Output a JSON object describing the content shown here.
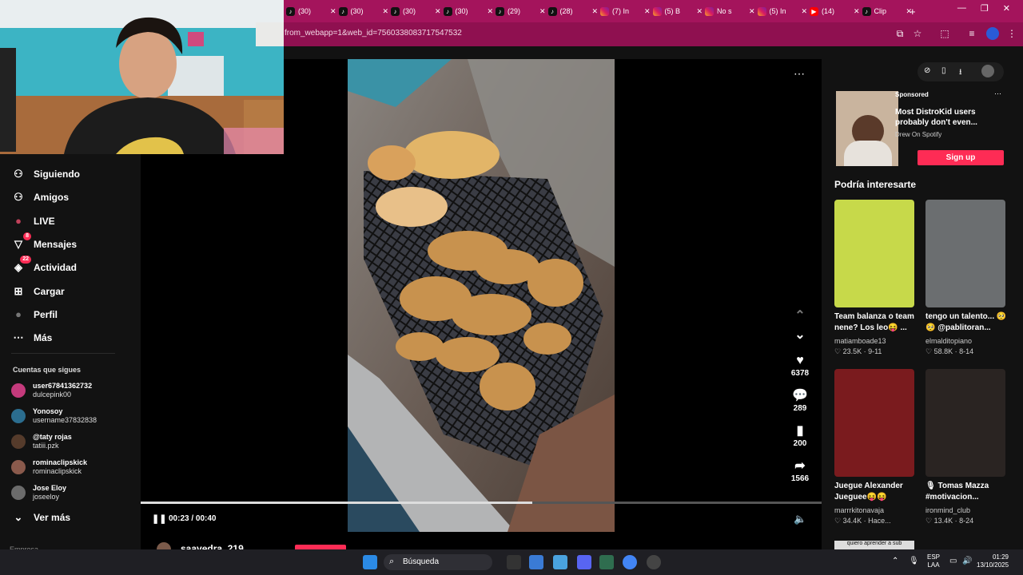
{
  "browser": {
    "tabs": [
      {
        "label": "(30)",
        "kind": "tiktok"
      },
      {
        "label": "(30)",
        "kind": "tiktok"
      },
      {
        "label": "(30)",
        "kind": "tiktok"
      },
      {
        "label": "(30)",
        "kind": "tiktok"
      },
      {
        "label": "(29)",
        "kind": "tiktok"
      },
      {
        "label": "(28)",
        "kind": "tiktok"
      },
      {
        "label": "(7) In",
        "kind": "instagram"
      },
      {
        "label": "(5) B",
        "kind": "instagram"
      },
      {
        "label": "No s",
        "kind": "instagram"
      },
      {
        "label": "(5) In",
        "kind": "instagram"
      },
      {
        "label": "(14)",
        "kind": "youtube"
      },
      {
        "label": "Clip",
        "kind": "tiktok"
      }
    ],
    "url": "from_webapp=1&web_id=7560338083717547532"
  },
  "sidebar": {
    "items": [
      {
        "label": "Siguiendo",
        "icon": "person-follow-icon"
      },
      {
        "label": "Amigos",
        "icon": "friends-icon"
      },
      {
        "label": "LIVE",
        "icon": "live-icon"
      },
      {
        "label": "Mensajes",
        "icon": "messages-icon",
        "badge": "8"
      },
      {
        "label": "Actividad",
        "icon": "activity-icon",
        "badge": "22"
      },
      {
        "label": "Cargar",
        "icon": "upload-icon"
      },
      {
        "label": "Perfil",
        "icon": "profile-icon"
      },
      {
        "label": "Más",
        "icon": "more-icon"
      }
    ],
    "following_title": "Cuentas que sigues",
    "accounts": [
      {
        "name": "user67841362732",
        "user": "dulcepink00",
        "color": "#c43a7c"
      },
      {
        "name": "Yonosoy",
        "user": "username37832838",
        "color": "#2b6d8f"
      },
      {
        "name": "@taty rojas",
        "user": "tatiii.pzk",
        "color": "#553b2b"
      },
      {
        "name": "rominaclipskick",
        "user": "rominaclipskick",
        "color": "#8a5a4c"
      },
      {
        "name": "Jose Eloy",
        "user": "joseeloy",
        "color": "#6b6b6b"
      }
    ],
    "see_more": "Ver más",
    "footer_partial": "Empresa"
  },
  "video": {
    "time": "00:23 / 00:40",
    "progress": 0.575,
    "author": "saavedra_219",
    "likes": "6378",
    "comments": "289",
    "saves": "200",
    "shares": "1566"
  },
  "ad": {
    "sponsored": "Sponsored",
    "title": "Most DistroKid users probably don't even...",
    "source": "Drew On Spotify",
    "cta": "Sign up"
  },
  "recommend": {
    "title": "Podría interesarte",
    "cards": [
      {
        "title": "Team balanza o team nene? Los leo😝 ...",
        "user": "matiamboade13",
        "meta": "♡ 23.5K · 9-11",
        "color": "#c7d94a"
      },
      {
        "title": "tengo un talento... 🥺🥺 @pablitoran...",
        "user": "elmalditopiano",
        "meta": "♡ 58.8K · 8-14",
        "color": "#6b6e70"
      },
      {
        "title": "Juegue Alexander Jueguee😝😝",
        "user": "marrrkitonavaja",
        "meta": "♡ 34.4K · Hace...",
        "color": "#7a1b1e"
      },
      {
        "title": "🎙 Tomas Mazza #motivacion...",
        "user": "ironmind_club",
        "meta": "♡ 13.4K · 8-24",
        "color": "#2a2422"
      }
    ],
    "partial_caption": "quiero aprender a sub"
  },
  "taskbar": {
    "search": "Búsqueda",
    "lang1": "ESP",
    "lang2": "LAA",
    "time": "01:29",
    "date": "13/10/2025"
  },
  "colors": {
    "accent": "#fe2c55",
    "chrome": "#a4145c"
  }
}
